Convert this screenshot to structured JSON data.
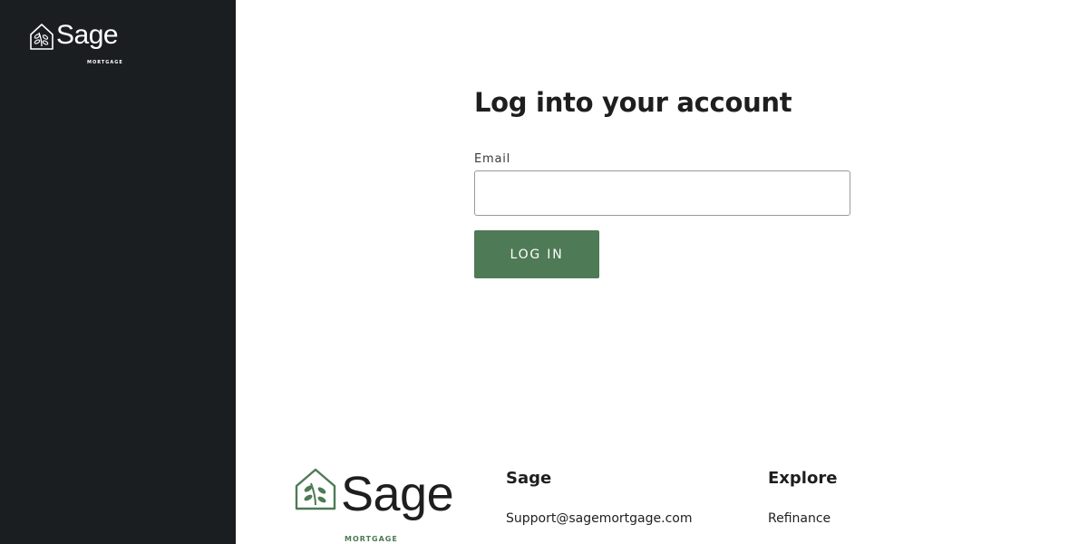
{
  "brand": {
    "name": "Sage",
    "tagline": "MORTGAGE",
    "accent_color": "#4e7a55",
    "sidebar_color": "#1b1e21"
  },
  "login": {
    "title": "Log into your account",
    "email_label": "Email",
    "email_value": "",
    "email_placeholder": "",
    "submit_label": "LOG IN"
  },
  "footer": {
    "columns": [
      {
        "title": "Sage",
        "links": [
          "Support@sagemortgage.com"
        ]
      },
      {
        "title": "Explore",
        "links": [
          "Refinance"
        ]
      }
    ]
  }
}
